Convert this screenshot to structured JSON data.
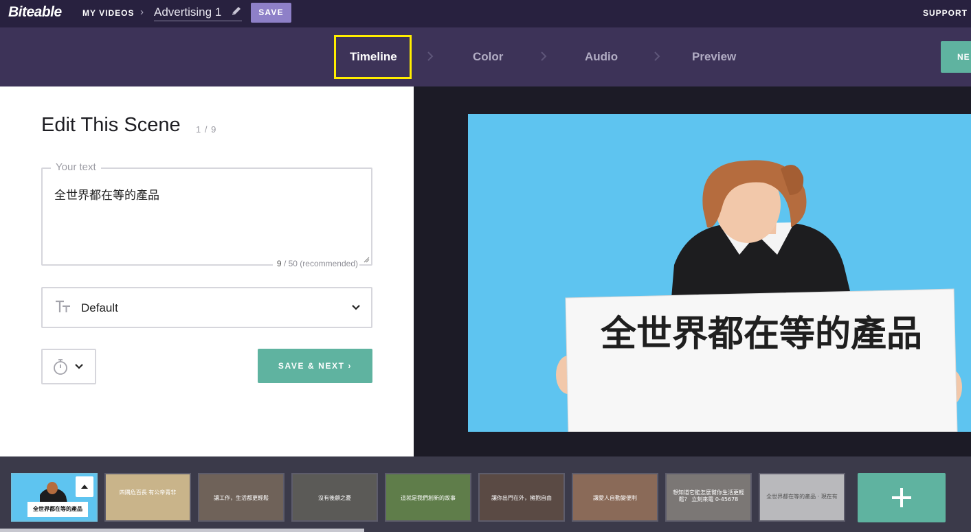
{
  "topbar": {
    "logo": "Biteable",
    "my_videos": "MY VIDEOS",
    "project_name": "Advertising 1",
    "save_label": "SAVE",
    "support_label": "SUPPORT"
  },
  "steps": [
    {
      "label": "Timeline",
      "active": true
    },
    {
      "label": "Color",
      "active": false
    },
    {
      "label": "Audio",
      "active": false
    },
    {
      "label": "Preview",
      "active": false
    }
  ],
  "next_label": "NE",
  "editor": {
    "title": "Edit This Scene",
    "scene_counter": "1 / 9",
    "text_field_legend": "Your text",
    "text_value": "全世界都在等的產品",
    "char_count": "9",
    "char_limit": "/ 50 (recommended)",
    "font_style": "Default",
    "save_next_label": "SAVE & NEXT ›"
  },
  "preview": {
    "sign_text": "全世界都在等的產品",
    "background_color": "#5ec4f0"
  },
  "thumbnails": [
    {
      "caption": "全世界都在等的產品",
      "active": true
    },
    {
      "caption": "四隅危百長 有公帝青非",
      "active": false
    },
    {
      "caption": "讓工作，生活都更輕鬆",
      "active": false
    },
    {
      "caption": "沒有後顧之憂",
      "active": false
    },
    {
      "caption": "這就是我們創新的故事",
      "active": false
    },
    {
      "caption": "讓你出門在外，擁抱自由",
      "active": false
    },
    {
      "caption": "讓愛人自動變便利",
      "active": false
    },
    {
      "caption": "想知道它能怎麼幫你生活更輕鬆？ 立刻來電 0-45678",
      "active": false
    },
    {
      "caption": "全世界都在等的產品 · 現在有",
      "active": false
    }
  ],
  "add_scene_label": "+",
  "colors": {
    "accent_teal": "#5fb3a0",
    "topbar": "#28213f",
    "stepbar": "#3d3358",
    "highlight": "#ffee00",
    "save_purple": "#8e80c8"
  }
}
